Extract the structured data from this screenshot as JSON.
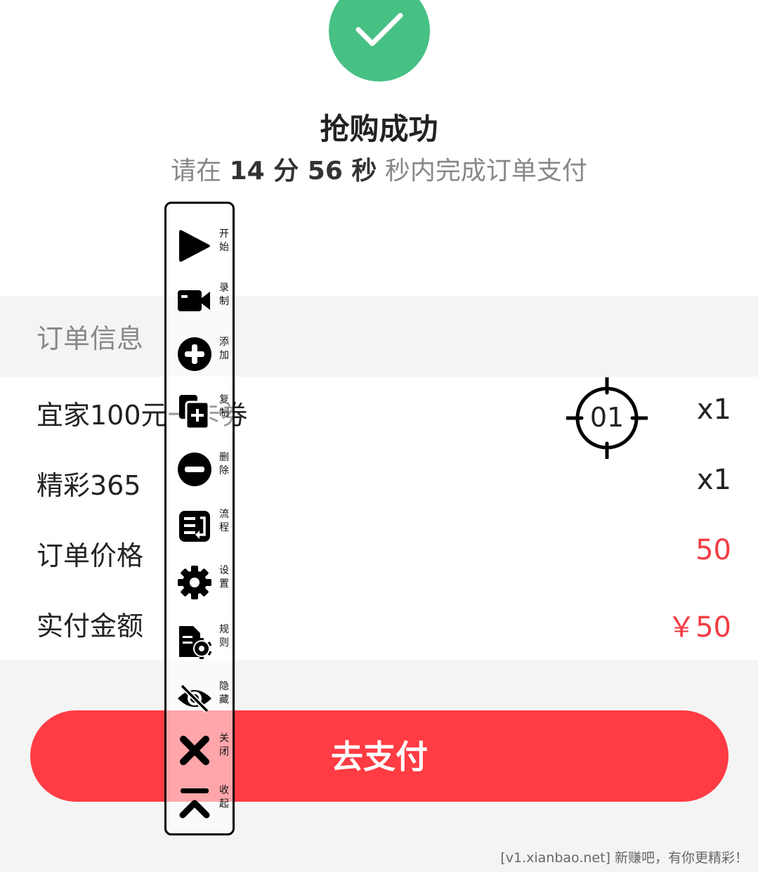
{
  "header": {
    "title": "抢购成功",
    "countdown": {
      "prefix": "请在 ",
      "minutes": "14",
      "minutes_unit": " 分 ",
      "seconds": "56",
      "seconds_unit": " 秒",
      "suffix": " 秒内完成订单支付"
    },
    "success_color": "#47c084",
    "icon": "check-icon"
  },
  "order": {
    "section_title": "订单信息",
    "rows": [
      {
        "label": "宜家100元一卡券",
        "value": "x1"
      },
      {
        "label": "精彩365",
        "value": "x1"
      },
      {
        "label": "订单价格",
        "value": "50"
      },
      {
        "label": "实付金额",
        "value": "￥50"
      }
    ]
  },
  "pay_button": {
    "label": "去支付",
    "color": "#ff3b43"
  },
  "crosshair": {
    "label": "01",
    "icon": "crosshair-icon"
  },
  "toolbar": {
    "items": [
      {
        "label": "开始",
        "icon": "play-icon"
      },
      {
        "label": "录制",
        "icon": "video-camera-icon"
      },
      {
        "label": "添加",
        "icon": "add-circle-icon"
      },
      {
        "label": "复制",
        "icon": "copy-icon"
      },
      {
        "label": "删除",
        "icon": "remove-circle-icon"
      },
      {
        "label": "流程",
        "icon": "flow-icon"
      },
      {
        "label": "设置",
        "icon": "gear-icon"
      },
      {
        "label": "规则",
        "icon": "rules-icon"
      },
      {
        "label": "隐藏",
        "icon": "eye-off-icon"
      },
      {
        "label": "关闭",
        "icon": "close-icon"
      },
      {
        "label": "收起",
        "icon": "collapse-icon"
      }
    ]
  },
  "footer": {
    "text": "[v1.xianbao.net] 新赚吧，有你更精彩！"
  },
  "accent_red": "#f33c44"
}
